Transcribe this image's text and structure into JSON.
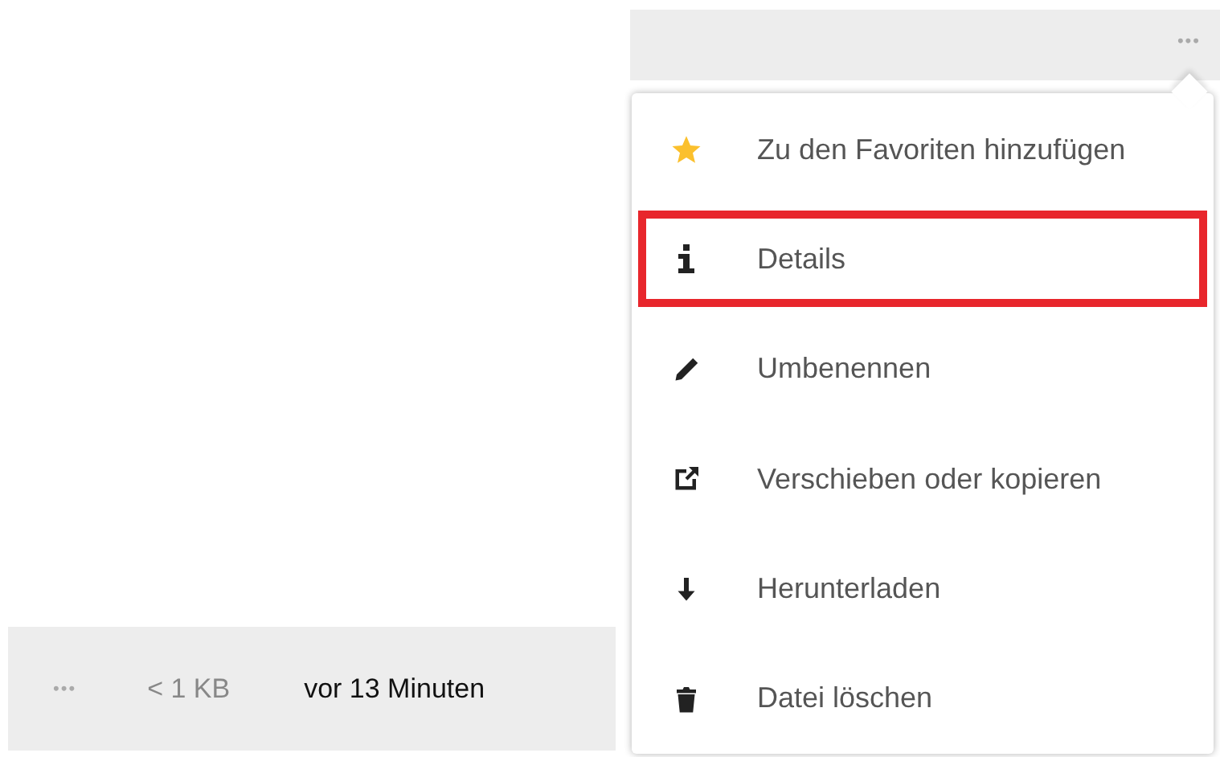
{
  "header_row": {
    "more_button": "•••"
  },
  "file_row": {
    "more_button": "•••",
    "size": "< 1 KB",
    "modified": "vor 13 Minuten"
  },
  "menu": {
    "items": [
      {
        "kind": "star",
        "label": "Zu den Favoriten hinzufügen",
        "highlighted": false
      },
      {
        "kind": "info",
        "label": "Details",
        "highlighted": true
      },
      {
        "kind": "rename",
        "label": "Umbenennen",
        "highlighted": false
      },
      {
        "kind": "move",
        "label": "Verschieben oder kopieren",
        "highlighted": false
      },
      {
        "kind": "download",
        "label": "Herunterladen",
        "highlighted": false
      },
      {
        "kind": "delete",
        "label": "Datei löschen",
        "highlighted": false
      }
    ]
  }
}
